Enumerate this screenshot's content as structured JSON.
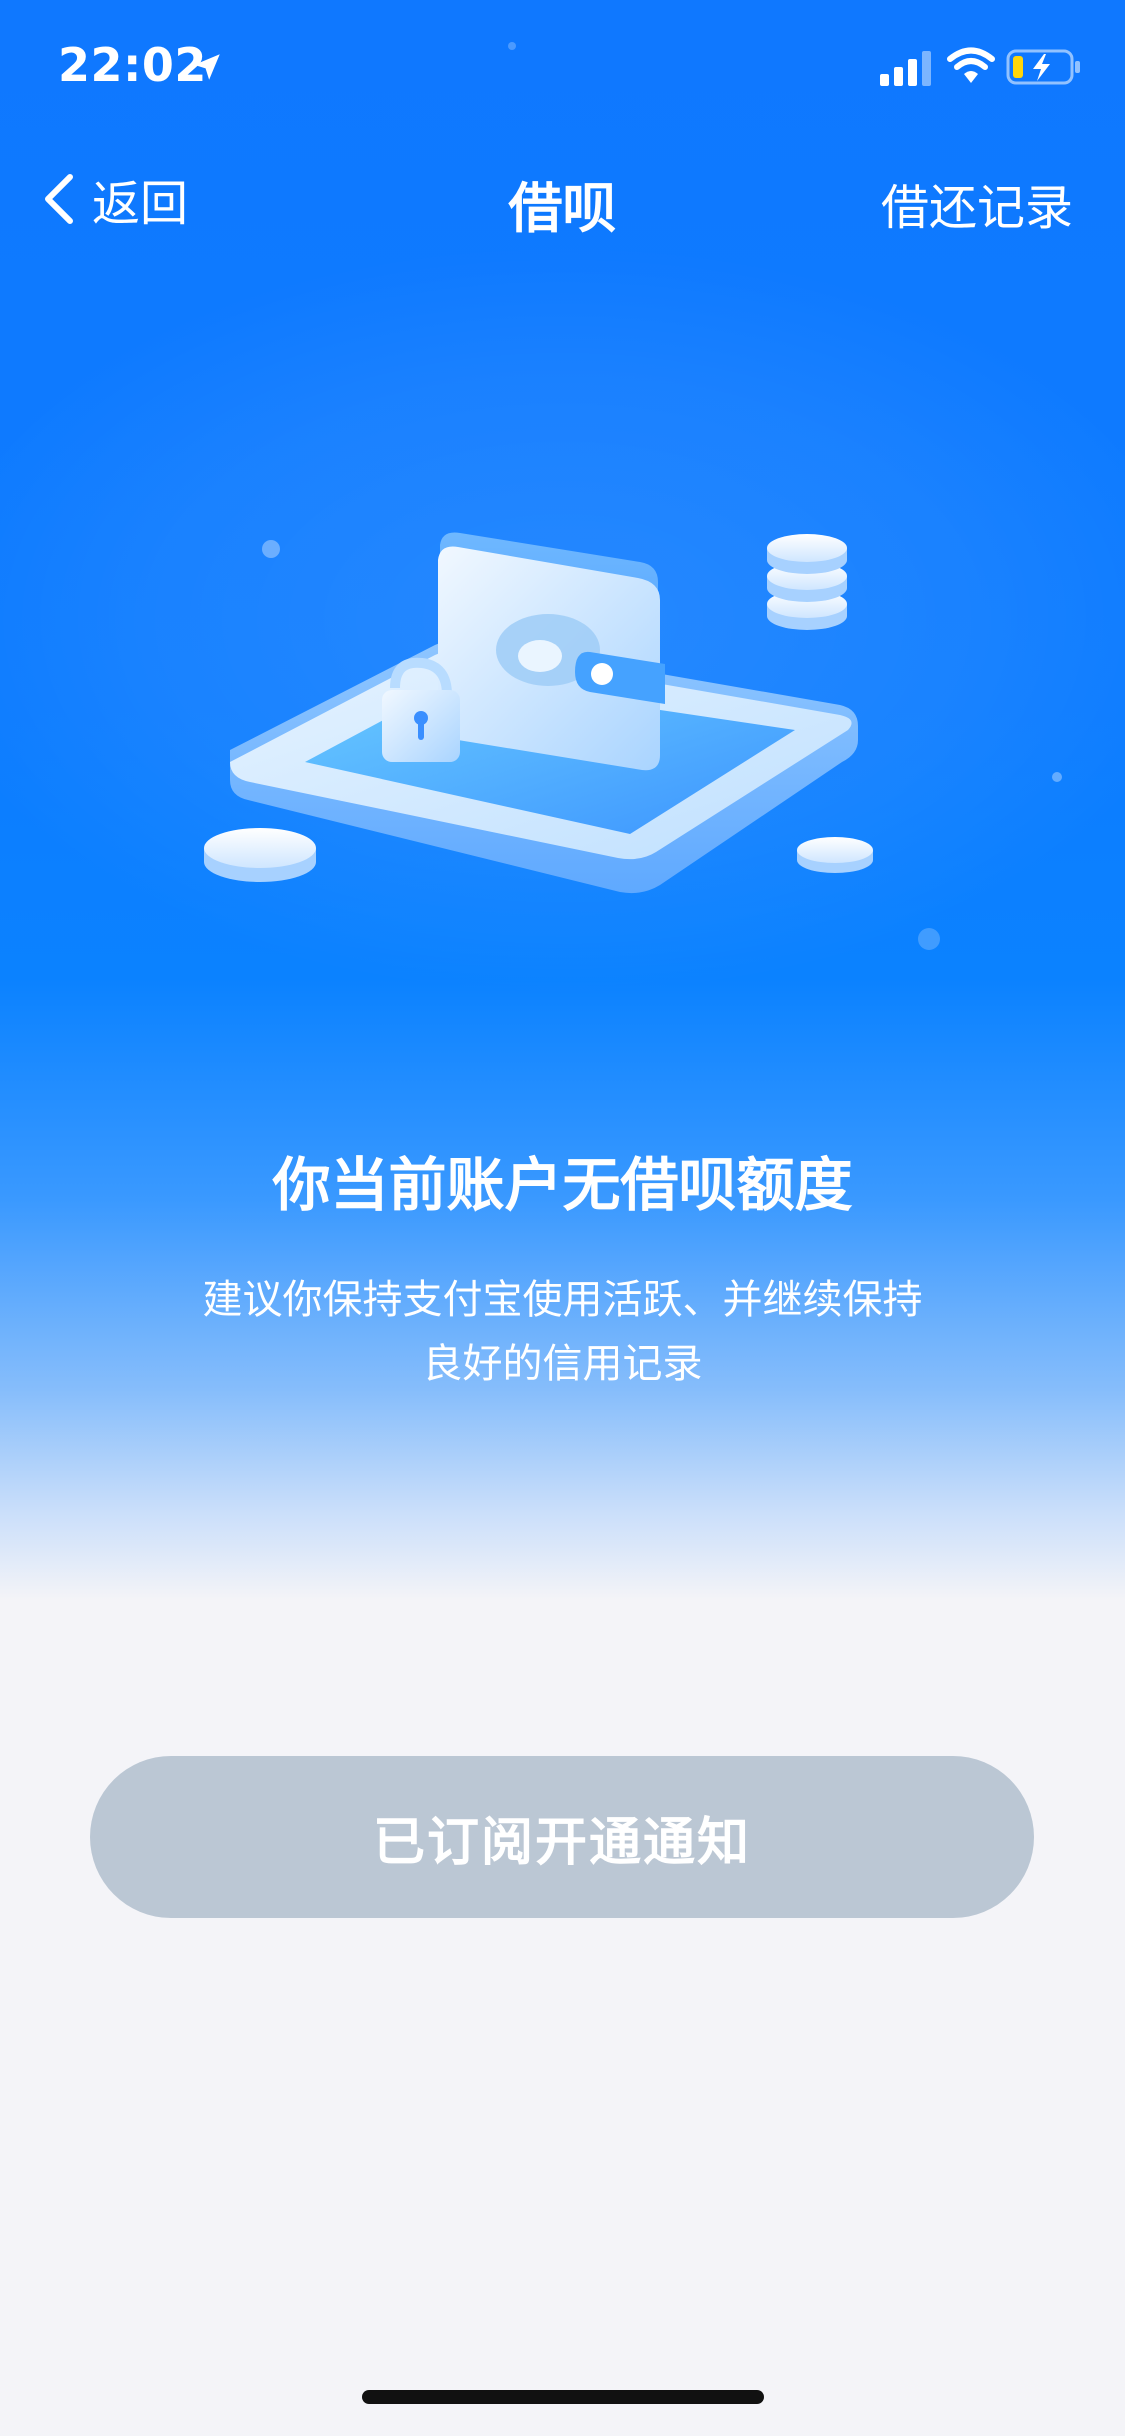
{
  "status_bar": {
    "time": "22:02",
    "icons": [
      "location-icon",
      "signal-icon",
      "wifi-icon",
      "battery-charging-icon"
    ]
  },
  "nav": {
    "back_label": "返回",
    "title": "借呗",
    "right_link": "借还记录"
  },
  "illustration": {
    "name": "wallet-lock-coins-illustration"
  },
  "message": {
    "title": "你当前账户无借呗额度",
    "body_line1": "建议你保持支付宝使用活跃、并继续保持",
    "body_line2": "良好的信用记录"
  },
  "actions": {
    "subscribe_label": "已订阅开通通知"
  },
  "colors": {
    "primary_blue": "#0f78ff",
    "page_bg": "#f4f4f8",
    "disabled_button": "#bbc7d4",
    "battery_yellow": "#ffd60a"
  }
}
